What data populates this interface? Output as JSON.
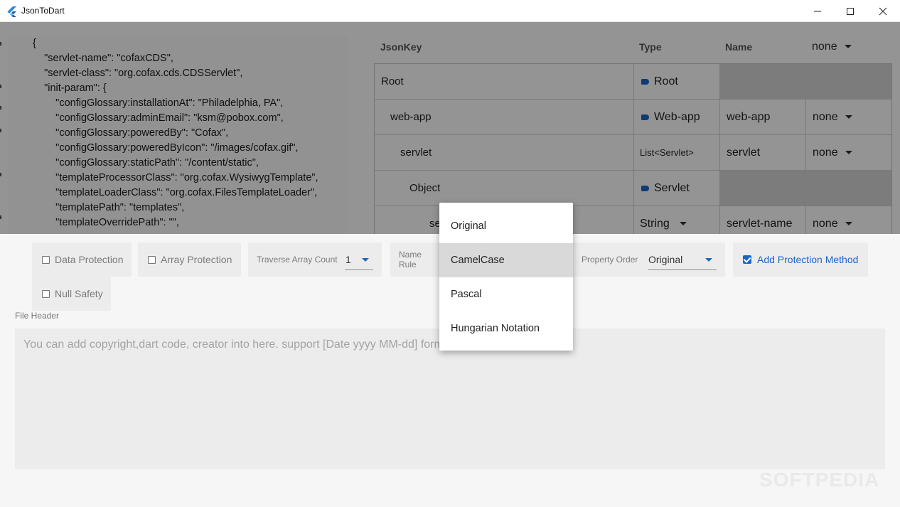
{
  "window": {
    "title": "JsonToDart"
  },
  "json_lines": [
    "  {",
    "    \"servlet-name\": \"cofaxCDS\",",
    "    \"servlet-class\": \"org.cofax.cds.CDSServlet\",",
    "    \"init-param\": {",
    "      \"configGlossary:installationAt\": \"Philadelphia, PA\",",
    "      \"configGlossary:adminEmail\": \"ksm@pobox.com\",",
    "      \"configGlossary:poweredBy\": \"Cofax\",",
    "      \"configGlossary:poweredByIcon\": \"/images/cofax.gif\",",
    "      \"configGlossary:staticPath\": \"/content/static\",",
    "      \"templateProcessorClass\": \"org.cofax.WysiwygTemplate\",",
    "      \"templateLoaderClass\": \"org.cofax.FilesTemplateLoader\",",
    "      \"templatePath\": \"templates\",",
    "      \"templateOverridePath\": \"\","
  ],
  "grid": {
    "headers": {
      "key": "JsonKey",
      "type": "Type",
      "name": "Name",
      "rule": "none"
    },
    "rows": [
      {
        "key": "Root",
        "type": "Root",
        "name": "",
        "rule": ""
      },
      {
        "key": "web-app",
        "type": "Web-app",
        "name": "web-app",
        "rule": "none"
      },
      {
        "key": "servlet",
        "type": "List<Servlet>",
        "name": "servlet",
        "rule": "none"
      },
      {
        "key": "Object",
        "type": "Servlet",
        "name": "",
        "rule": ""
      },
      {
        "key": "se",
        "type": "String",
        "name": "servlet-name",
        "rule": "none"
      }
    ]
  },
  "options": {
    "data_protection": {
      "label": "Data Protection",
      "checked": false
    },
    "array_protection": {
      "label": "Array Protection",
      "checked": false
    },
    "traverse_array_count": {
      "label": "Traverse Array Count",
      "value": "1"
    },
    "name_rule": {
      "label": "Name Rule"
    },
    "property_order": {
      "label": "Property Order",
      "value": "Original"
    },
    "add_protection_method": {
      "label": "Add Protection Method",
      "checked": true
    },
    "null_safety": {
      "label": "Null Safety",
      "checked": false
    }
  },
  "file_header": {
    "label": "File Header",
    "placeholder": "You can add copyright,dart code, creator into here. support [Date yyyy MM-dd] format to generate"
  },
  "name_rule_menu": {
    "items": [
      "Original",
      "CamelCase",
      "Pascal",
      "Hungarian Notation"
    ],
    "highlighted": "CamelCase"
  },
  "watermark": "SOFTPEDIA",
  "colors": {
    "accent": "#1a66c8",
    "overlay": "rgba(0,0,0,0.42)",
    "highlight": "#d9d9d9"
  }
}
